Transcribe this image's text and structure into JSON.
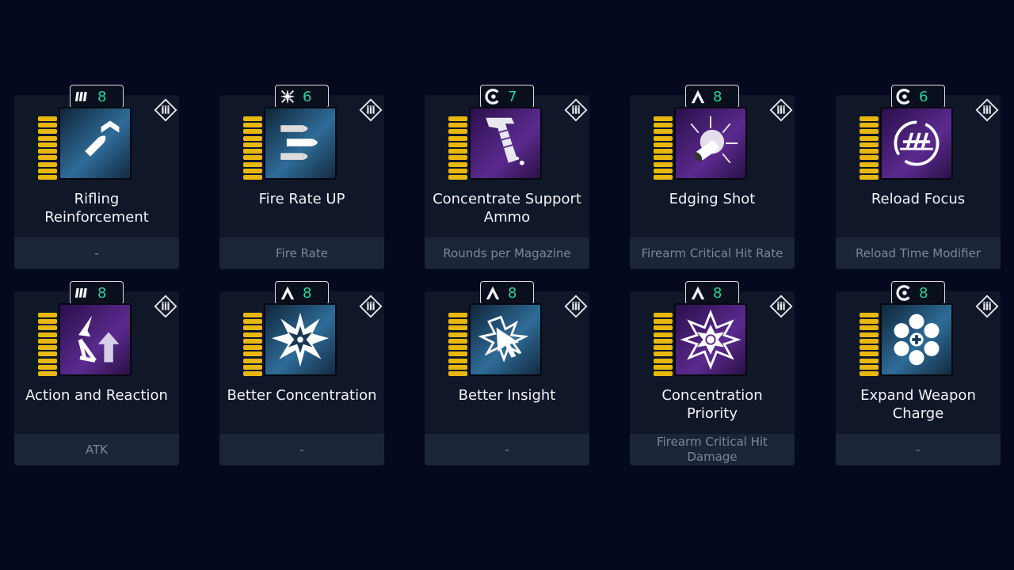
{
  "modules": [
    {
      "name": "Rifling Reinforcement",
      "stat": "-",
      "socket": "rifling-socket-icon",
      "cost": "8",
      "icon": "rifling-bullet-icon",
      "tint": "blue"
    },
    {
      "name": "Fire Rate UP",
      "stat": "Fire Rate",
      "socket": "star-socket-icon",
      "cost": "6",
      "icon": "three-bullets-icon",
      "tint": "blue"
    },
    {
      "name": "Concentrate Support Ammo",
      "stat": "Rounds per Magazine",
      "socket": "crescent-socket-icon",
      "cost": "7",
      "icon": "magazine-icon",
      "tint": "purple"
    },
    {
      "name": "Edging Shot",
      "stat": "Firearm Critical Hit Rate",
      "socket": "chevron-socket-icon",
      "cost": "8",
      "icon": "shell-burst-icon",
      "tint": "purple"
    },
    {
      "name": "Reload Focus",
      "stat": "Reload Time Modifier",
      "socket": "crescent-socket-icon",
      "cost": "6",
      "icon": "reload-rounds-icon",
      "tint": "purple"
    },
    {
      "name": "Action and Reaction",
      "stat": "ATK",
      "socket": "rifling-socket-icon",
      "cost": "8",
      "icon": "arrows-icon",
      "tint": "purple"
    },
    {
      "name": "Better Concentration",
      "stat": "-",
      "socket": "chevron-socket-icon",
      "cost": "8",
      "icon": "starburst-icon",
      "tint": "blue"
    },
    {
      "name": "Better Insight",
      "stat": "-",
      "socket": "chevron-socket-icon",
      "cost": "8",
      "icon": "cursor-burst-icon",
      "tint": "blue"
    },
    {
      "name": "Concentration Priority",
      "stat": "Firearm Critical Hit Damage",
      "socket": "chevron-socket-icon",
      "cost": "8",
      "icon": "spiked-star-icon",
      "tint": "purple"
    },
    {
      "name": "Expand Weapon Charge",
      "stat": "-",
      "socket": "crescent-socket-icon",
      "cost": "8",
      "icon": "revolver-cylinder-icon",
      "tint": "blue"
    }
  ],
  "colors": {
    "background": "#04091f",
    "card": "#0f1728",
    "capacity": "#e8b80f",
    "cost": "#26d39a"
  }
}
